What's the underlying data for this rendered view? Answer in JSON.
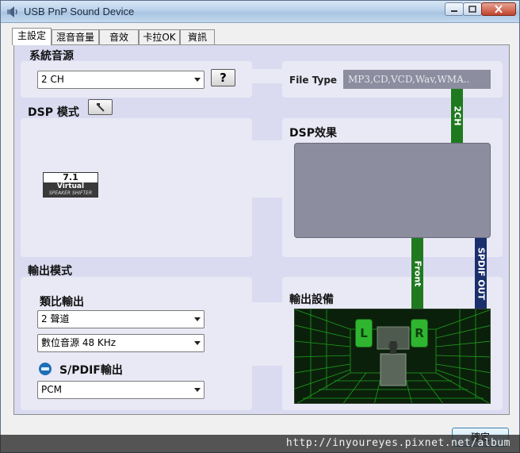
{
  "window": {
    "title": "USB PnP Sound Device"
  },
  "tabs": [
    {
      "label": "主設定",
      "active": true
    },
    {
      "label": "混音音量",
      "active": false
    },
    {
      "label": "音效",
      "active": false
    },
    {
      "label": "卡拉OK",
      "active": false
    },
    {
      "label": "資訊",
      "active": false
    }
  ],
  "system_source": {
    "heading": "系統音源",
    "channel_select": "2 CH",
    "help_button": "?"
  },
  "file_type": {
    "label": "File Type",
    "value": "MP3,CD,VCD,Wav,WMA.."
  },
  "dsp_mode": {
    "heading": "DSP 模式",
    "logo": {
      "line1": "7.1",
      "line2": "Virtual",
      "line3": "SPEAKER SHIFTER"
    }
  },
  "dsp_effect": {
    "heading": "DSP效果"
  },
  "signal_bars": {
    "top": "2CH",
    "front": "Front",
    "spdif": "SPDIF OUT"
  },
  "output_mode": {
    "heading": "輸出模式",
    "analog_label": "類比輸出",
    "analog_select": "2 聲道",
    "digital_select": "數位音源 48 KHz",
    "spdif_label": "S/PDIF輸出",
    "spdif_select": "PCM"
  },
  "output_device": {
    "heading": "輸出設備",
    "speaker_left": "L",
    "speaker_right": "R"
  },
  "ok_button": "確定",
  "watermark": "http://inyoureyes.pixnet.net/album",
  "colors": {
    "panel": "#dadbf0",
    "box": "#e9e9f5",
    "green_bar": "#1f7a1f",
    "spdif_bar": "#1a2f6b",
    "display": "#8c8d9e"
  }
}
